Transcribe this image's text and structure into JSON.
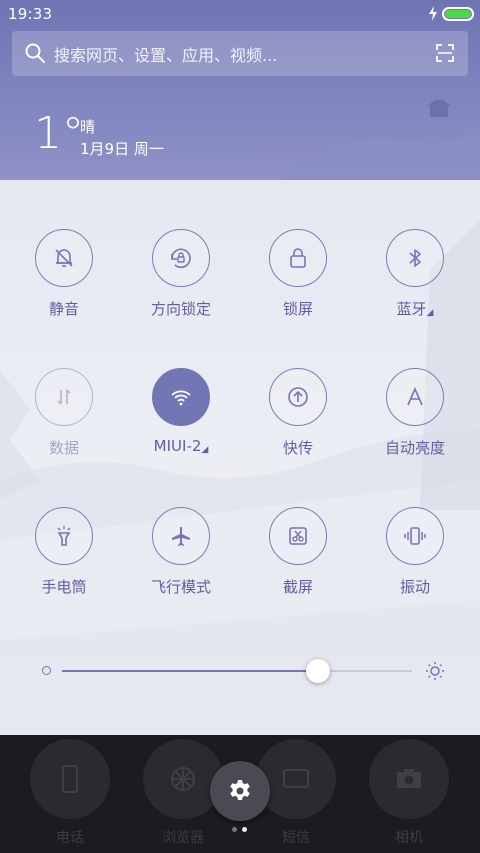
{
  "status_bar": {
    "time": "19:33"
  },
  "search": {
    "placeholder": "搜索网页、设置、应用、视频..."
  },
  "weather": {
    "temperature": "1°",
    "condition": "晴",
    "date": "1月9日 周一"
  },
  "tiles": [
    {
      "label": "静音",
      "icon": "bell-off-icon",
      "state": "off"
    },
    {
      "label": "方向锁定",
      "icon": "rotation-lock-icon",
      "state": "off"
    },
    {
      "label": "锁屏",
      "icon": "lock-icon",
      "state": "off"
    },
    {
      "label": "蓝牙",
      "icon": "bluetooth-icon",
      "state": "off",
      "has_menu": true
    },
    {
      "label": "数据",
      "icon": "data-arrows-icon",
      "state": "disabled"
    },
    {
      "label": "MIUI-2",
      "icon": "wifi-icon",
      "state": "on",
      "has_menu": true
    },
    {
      "label": "快传",
      "icon": "quick-transfer-icon",
      "state": "off"
    },
    {
      "label": "自动亮度",
      "icon": "auto-brightness-icon",
      "state": "off"
    },
    {
      "label": "手电筒",
      "icon": "flashlight-icon",
      "state": "off"
    },
    {
      "label": "飞行模式",
      "icon": "airplane-icon",
      "state": "off"
    },
    {
      "label": "截屏",
      "icon": "screenshot-icon",
      "state": "off"
    },
    {
      "label": "振动",
      "icon": "vibrate-icon",
      "state": "off"
    }
  ],
  "brightness": {
    "level": 0.73
  },
  "dock": [
    {
      "label": "电话",
      "icon": "phone-icon"
    },
    {
      "label": "浏览器",
      "icon": "browser-icon"
    },
    {
      "label": "短信",
      "icon": "messages-icon"
    },
    {
      "label": "相机",
      "icon": "camera-icon"
    }
  ],
  "colors": {
    "accent": "#7376b5",
    "header": "#7d82bd",
    "battery": "#4ed64b"
  }
}
